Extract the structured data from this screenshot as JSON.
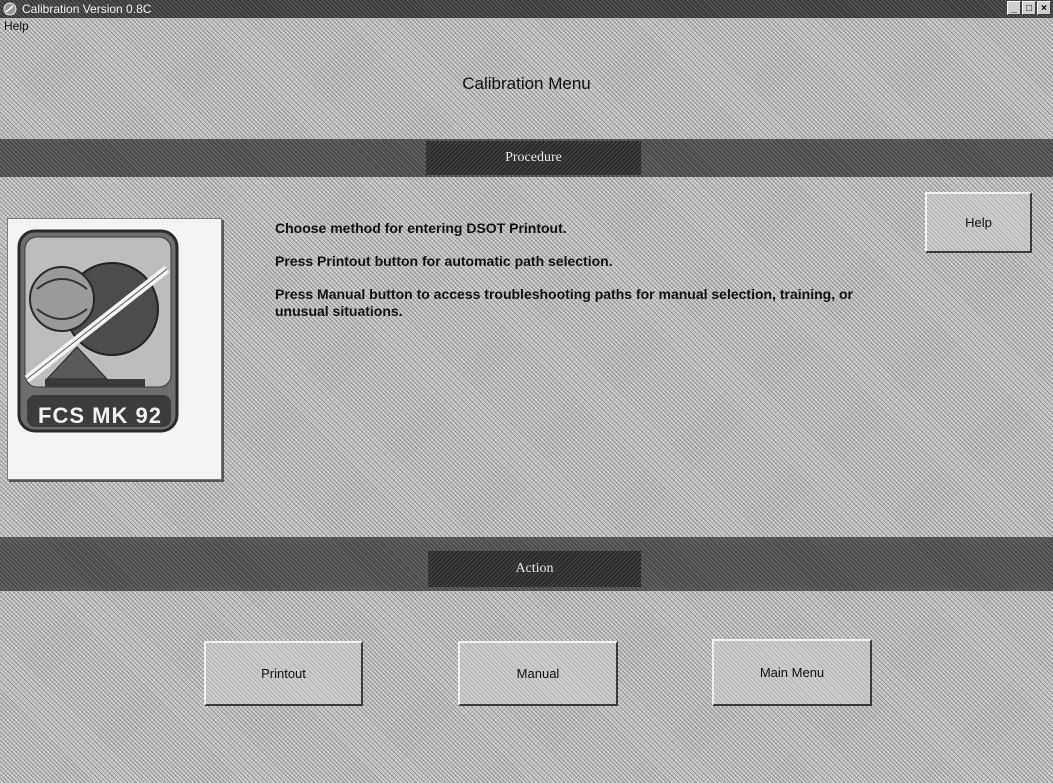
{
  "window": {
    "title": "Calibration Version 0.8C",
    "minimize_glyph": "_",
    "maximize_glyph": "□",
    "close_glyph": "×"
  },
  "menubar": {
    "help": "Help"
  },
  "header": {
    "title": "Calibration Menu"
  },
  "procedure": {
    "section_label": "Procedure",
    "help_button": "Help",
    "logo_text": "FCS MK 92",
    "instructions": [
      "Choose method for entering DSOT Printout.",
      "Press Printout button for automatic path selection.",
      "Press Manual button to access troubleshooting paths for manual selection, training, or unusual situations."
    ]
  },
  "action": {
    "section_label": "Action",
    "buttons": [
      "Printout",
      "Manual",
      "Main Menu"
    ]
  },
  "icons": {
    "app": "app-icon",
    "logo": "radar-dish-logo"
  }
}
